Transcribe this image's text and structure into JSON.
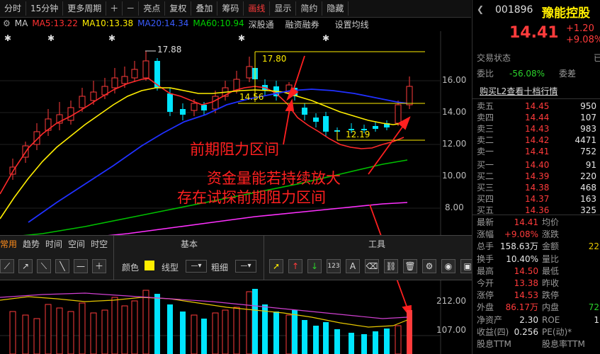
{
  "toolbar": {
    "items": [
      "分时",
      "15分钟",
      "更多周期",
      "＋",
      "－",
      "亮点",
      "复权",
      "叠加",
      "筹码",
      "画线",
      "显示",
      "简约",
      "隐藏"
    ],
    "active": "画线"
  },
  "legend": {
    "ma_label": "MA",
    "ma5": "MA5:13.22",
    "ma10": "MA10:13.38",
    "ma20": "MA20:14.34",
    "ma60": "MA60:10.94",
    "shengutong": "深股通",
    "rongzi": "融资融券",
    "setting": "设置均线"
  },
  "chart_annotations": {
    "high_label": "17.88",
    "box_top": "17.80",
    "box_mid": "14.56",
    "box_low": "12.19",
    "text1": "前期阻力区间",
    "text2": "资金量能若持续放大",
    "text3": "存在试探前期阻力区间"
  },
  "price_axis": [
    "16.00",
    "14.00",
    "12.00",
    "10.00",
    "8.00"
  ],
  "volume_axis": [
    "212.00",
    "107.00"
  ],
  "panel": {
    "tabs": [
      "常用",
      "趋势",
      "时间",
      "空间",
      "时空"
    ],
    "section_basic": "基本",
    "section_tool": "工具",
    "color_label": "颜色",
    "linetype_label": "线型",
    "thickness_label": "粗细"
  },
  "stock": {
    "code": "001896",
    "name": "豫能控股",
    "price": "14.41",
    "change": "+1.20",
    "change_pct": "+9.08%",
    "status_label": "交易状态",
    "status_value": "已",
    "weibi_label": "委比",
    "weibi_value": "-56.08%",
    "weicha_label": "委差",
    "l2_link": "购买L2查看十档行情"
  },
  "order_book": {
    "sell": [
      {
        "label": "卖五",
        "price": "14.45",
        "vol": "950"
      },
      {
        "label": "卖四",
        "price": "14.44",
        "vol": "107"
      },
      {
        "label": "卖三",
        "price": "14.43",
        "vol": "983"
      },
      {
        "label": "卖二",
        "price": "14.42",
        "vol": "4471"
      },
      {
        "label": "卖一",
        "price": "14.41",
        "vol": "752"
      }
    ],
    "buy": [
      {
        "label": "买一",
        "price": "14.40",
        "vol": "91"
      },
      {
        "label": "买二",
        "price": "14.39",
        "vol": "220"
      },
      {
        "label": "买三",
        "price": "14.38",
        "vol": "468"
      },
      {
        "label": "买四",
        "price": "14.37",
        "vol": "163"
      },
      {
        "label": "买五",
        "price": "14.36",
        "vol": "325"
      }
    ]
  },
  "stats": [
    {
      "l1": "最新",
      "v1": "14.41",
      "c1": "red",
      "l2": "均价",
      "v2": "",
      "c2": "red"
    },
    {
      "l1": "涨幅",
      "v1": "+9.08%",
      "c1": "red",
      "l2": "涨跌",
      "v2": "",
      "c2": "red"
    },
    {
      "l1": "总手",
      "v1": "158.63万",
      "c1": "white",
      "l2": "金额",
      "v2": "22",
      "c2": "yellow"
    },
    {
      "l1": "换手",
      "v1": "10.40%",
      "c1": "white",
      "l2": "量比",
      "v2": "",
      "c2": "white"
    },
    {
      "l1": "最高",
      "v1": "14.50",
      "c1": "red",
      "l2": "最低",
      "v2": "",
      "c2": "red"
    },
    {
      "l1": "今开",
      "v1": "13.38",
      "c1": "red",
      "l2": "昨收",
      "v2": "",
      "c2": "white"
    },
    {
      "l1": "涨停",
      "v1": "14.53",
      "c1": "red",
      "l2": "跌停",
      "v2": "",
      "c2": "green"
    },
    {
      "l1": "外盘",
      "v1": "86.17万",
      "c1": "red",
      "l2": "内盘",
      "v2": "72",
      "c2": "green"
    },
    {
      "l1": "净资产",
      "v1": "2.30",
      "c1": "white",
      "l2": "ROE",
      "v2": "1",
      "c2": "white"
    },
    {
      "l1": "收益(四)",
      "v1": "0.256",
      "c1": "white",
      "l2": "PE(动)*",
      "v2": "",
      "c2": "white"
    },
    {
      "l1": "股息TTM",
      "v1": "",
      "c1": "white",
      "l2": "股息率TTM",
      "v2": "",
      "c2": "white"
    }
  ],
  "colors": {
    "up": "#ff3b3b",
    "down": "#00e5ff",
    "ma5": "#ff3030",
    "ma10": "#ffee00",
    "ma20": "#2020ff",
    "ma60": "#00c000",
    "ma120": "#ff30ff"
  }
}
